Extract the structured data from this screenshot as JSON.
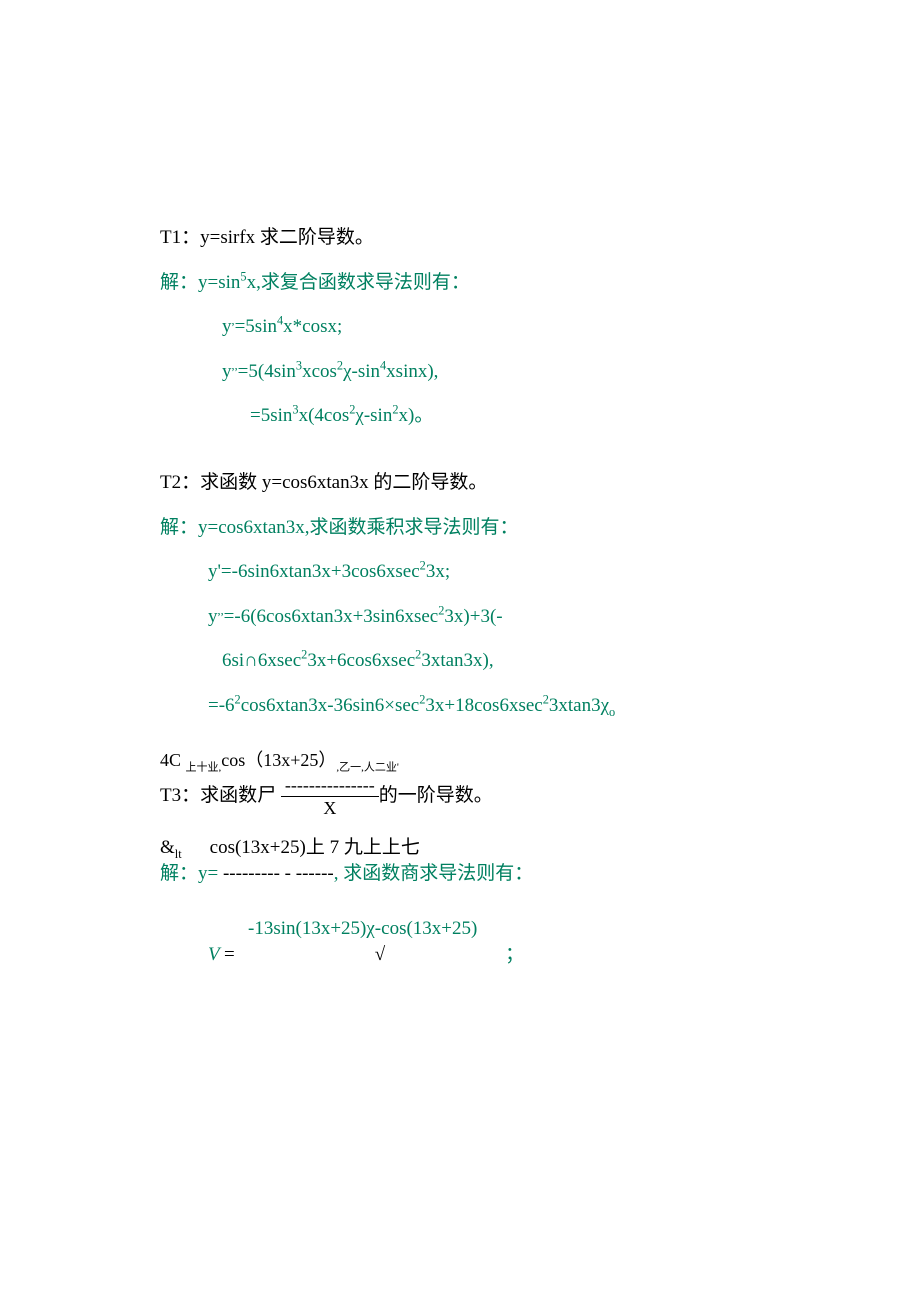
{
  "t1": {
    "title_pre": "T1：",
    "title_rest": "y=sirfx 求二阶导数。",
    "sol_label": "解：",
    "sol_line1_rest": "y=sin",
    "sol_line1_sup": "5",
    "sol_line1_end": "x,求复合函数求导法则有：",
    "l2_a": "y",
    "l2_sup1": ",",
    "l2_b": "=5sin",
    "l2_sup2": "4",
    "l2_c": "x*cosx;",
    "l3_a": "y",
    "l3_sup1": ",,",
    "l3_b": "=5(4sin",
    "l3_sup2": "3",
    "l3_c": "xcos",
    "l3_sup3": "2",
    "l3_d": "χ-sin",
    "l3_sup4": "4",
    "l3_e": "xsinx),",
    "l4_a": "=5sin",
    "l4_sup1": "3",
    "l4_b": "x(4cos",
    "l4_sup2": "2",
    "l4_c": "χ-sin",
    "l4_sup3": "2",
    "l4_d": "x)。"
  },
  "t2": {
    "title_pre": "T2：",
    "title_rest": "求函数 y=cos6xtan3x 的二阶导数。",
    "sol_label": "解：",
    "sol_line1_rest": "y=cos6xtan3x,求函数乘积求导法则有：",
    "l2": "y'=-6sin6xtan3x+3cos6xsec",
    "l2_sup": "2",
    "l2_end": "3x;",
    "l3_a": "y",
    "l3_sup1": ",,",
    "l3_b": "=-6(6cos6xtan3x+3sin6xsec",
    "l3_sup2": "2",
    "l3_c": "3x)+3(-",
    "l4_a": "6si∩6xsec",
    "l4_sup1": "2",
    "l4_b": "3x+6cos6xsec",
    "l4_sup2": "2",
    "l4_c": "3xtan3x),",
    "l5_a": "=-6",
    "l5_sup1": "2",
    "l5_b": "cos6xtan3x-36sin6×sec",
    "l5_sup2": "2",
    "l5_c": "3x+18cos6xsec",
    "l5_sup3": "2",
    "l5_d": "3xtan3χ",
    "l5_sub": "o"
  },
  "t3": {
    "pre_a": "4C ",
    "pre_tiny1": "上十业,",
    "pre_b": "cos（13x+25）",
    "pre_tiny2": ",乙一,人二业'",
    "title_pre": "T3：",
    "title_mid": "求函数尸 ",
    "dashes": "---------------",
    "title_end": "的一阶导数。",
    "denom": "X",
    "amp": "&",
    "amp_sub": "lt",
    "mid_black": "cos(13x+25)上 7 九上上七",
    "sol_label": "解：",
    "sol_rest_a": "y= ",
    "sol_dashes": "--------- - ------",
    "sol_rest_b": ", 求函数商求导法则有：",
    "last_top": "-13sin(13x+25)χ-cos(13x+25)",
    "last_v": "V ",
    "last_eq": "=",
    "last_root": "√",
    "last_semi": "；"
  }
}
